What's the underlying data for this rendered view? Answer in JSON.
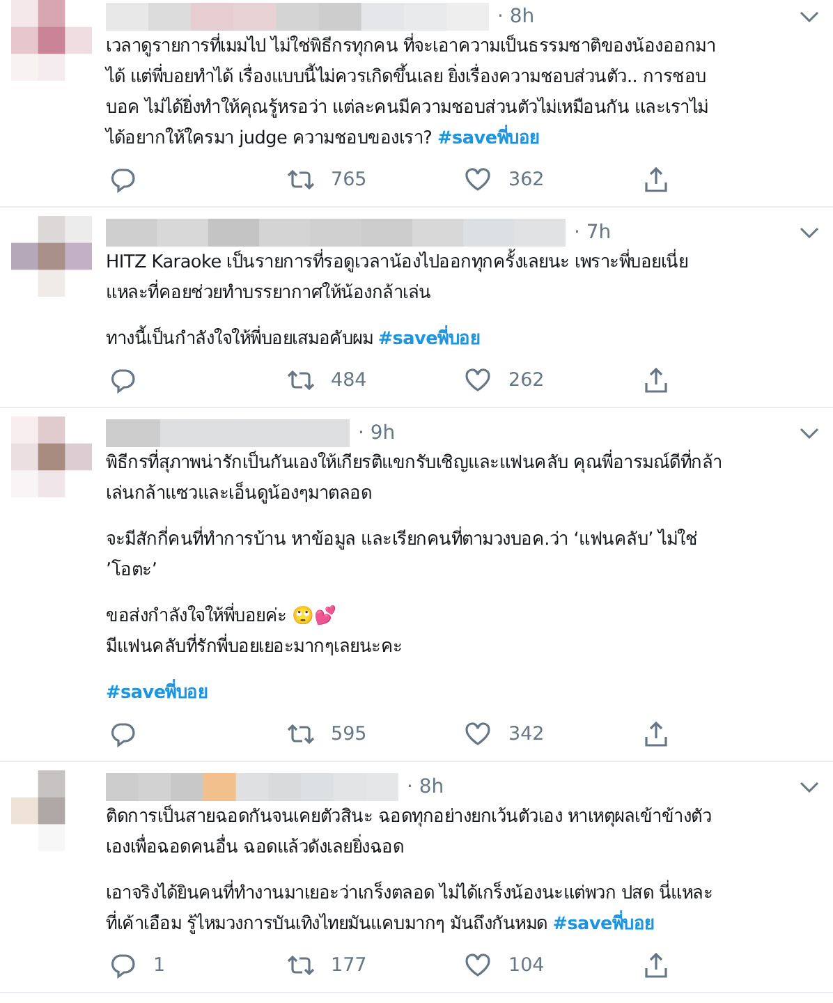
{
  "tweets": [
    {
      "time": "· 8h",
      "paragraphs": [
        [
          {
            "text": "เวลาดูรายการที่เมมไป ไม่ใช่พิธีกรทุกคน ที่จะเอาความเป็นธรรมชาติของน้องออกมา"
          },
          {
            "text": "ได้ แต่พี่บอยทำได้ เรื่องแบบนี้ไม่ควรเกิดขึ้นเลย ยิ่งเรื่องความชอบส่วนตัว.. การชอบ"
          },
          {
            "text": "บอค ไม่ได้ยิ่งทำให้คุณรู้หรอว่า แต่ละคนมีความชอบส่วนตัวไม่เหมือนกัน และเราไม่"
          },
          {
            "text": "ได้อยากให้ใครมา judge ความชอบของเรา?",
            "hashtag": "#saveพี่บอย"
          }
        ]
      ],
      "retweets": "765",
      "likes": "362"
    },
    {
      "time": "· 7h",
      "paragraphs": [
        [
          {
            "text": "HITZ Karaoke เป็นรายการที่รอดูเวลาน้องไปออกทุกครั้งเลยนะ เพราะพี่บอยเนี่ย"
          },
          {
            "text": "แหละที่คอยช่วยทำบรรยากาศให้น้องกล้าเล่น"
          }
        ],
        [
          {
            "text": "ทางนี้เป็นกำลังใจให้พี่บอยเสมอคับผม",
            "hashtag": "#saveพี่บอย"
          }
        ]
      ],
      "retweets": "484",
      "likes": "262"
    },
    {
      "time": "· 9h",
      "paragraphs": [
        [
          {
            "text": "พิธีกรที่สุภาพน่ารักเป็นกันเองให้เกียรติแขกรับเชิญและแฟนคลับ คุณพี่อารมณ์ดีที่กล้า"
          },
          {
            "text": "เล่นกล้าแซวและเอ็นดูน้องๆมาตลอด"
          }
        ],
        [
          {
            "text": "จะมีสักกี่คนที่ทำการบ้าน หาข้อมูล และเรียกคนที่ตามวงบอค.ว่า ‘แฟนคลับ’ ไม่ใช่"
          },
          {
            "text": "’โอตะ’"
          }
        ],
        [
          {
            "text": "ขอส่งกำลังใจให้พี่บอยค่ะ 🙄💕"
          },
          {
            "text": "มีแฟนคลับที่รักพี่บอยเยอะมากๆเลยนะคะ"
          }
        ],
        [
          {
            "hashtag": "#saveพี่บอย"
          }
        ]
      ],
      "retweets": "595",
      "likes": "342"
    },
    {
      "time": "· 8h",
      "paragraphs": [
        [
          {
            "text": "ติดการเป็นสายฉอดกันจนเคยตัวสินะ ฉอดทุกอย่างยกเว้นตัวเอง หาเหตุผลเข้าข้างตัว"
          },
          {
            "text": "เองเพื่อฉอดคนอื่น ฉอดแล้วดังเลยยิ่งฉอด"
          }
        ],
        [
          {
            "text": "เอาจริงได้ยินคนที่ทำงานมาเยอะว่าเกร็งตลอด ไม่ได้เกร็งน้องนะแต่พวก ปสด นี่แหละ"
          },
          {
            "text": "ที่เค้าเอือม รู้ไหมวงการบันเทิงไทยมันแคบมากๆ มันถึงกันหมด",
            "hashtag": "#saveพี่บอย"
          }
        ]
      ],
      "replies": "1",
      "retweets": "177",
      "likes": "104"
    }
  ]
}
